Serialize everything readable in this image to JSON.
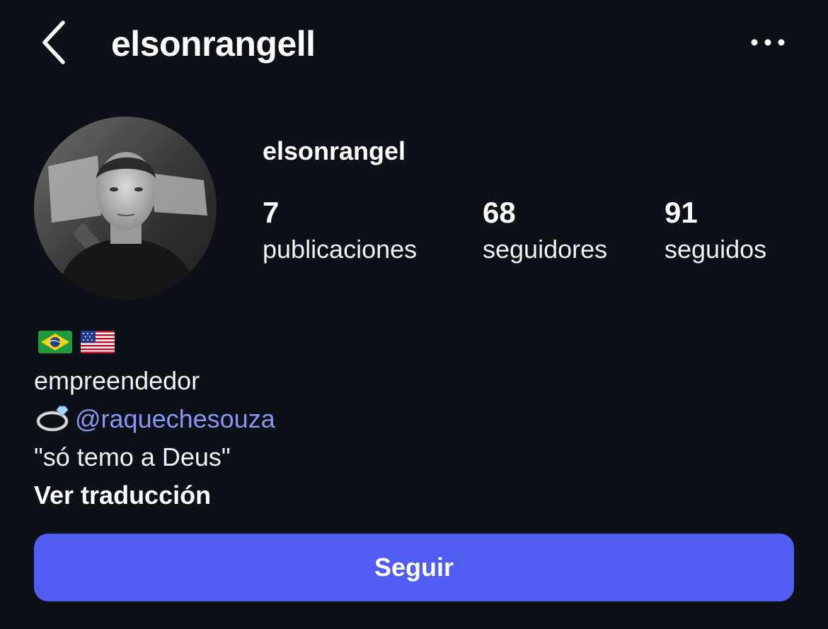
{
  "header": {
    "username": "elsonrangell",
    "back_icon": "chevron-left-icon",
    "more_icon": "more-horizontal-icon"
  },
  "profile": {
    "name": "elsonrangel",
    "avatar": "profile-photo"
  },
  "stats": [
    {
      "value": "7",
      "label": "publicaciones"
    },
    {
      "value": "68",
      "label": "seguidores"
    },
    {
      "value": "91",
      "label": "seguidos"
    }
  ],
  "bio": {
    "flags": [
      "brazil-flag-icon",
      "usa-flag-icon"
    ],
    "line1": "empreendedor",
    "ring_icon": "ring-icon",
    "mention": "@raquechesouza",
    "quote": "\"só temo a Deus\"",
    "translate": "Ver traducción"
  },
  "actions": {
    "follow": "Seguir"
  },
  "colors": {
    "background": "#0d1117",
    "accent": "#4f5df0",
    "mention": "#8b93f5",
    "text": "#ffffff"
  }
}
